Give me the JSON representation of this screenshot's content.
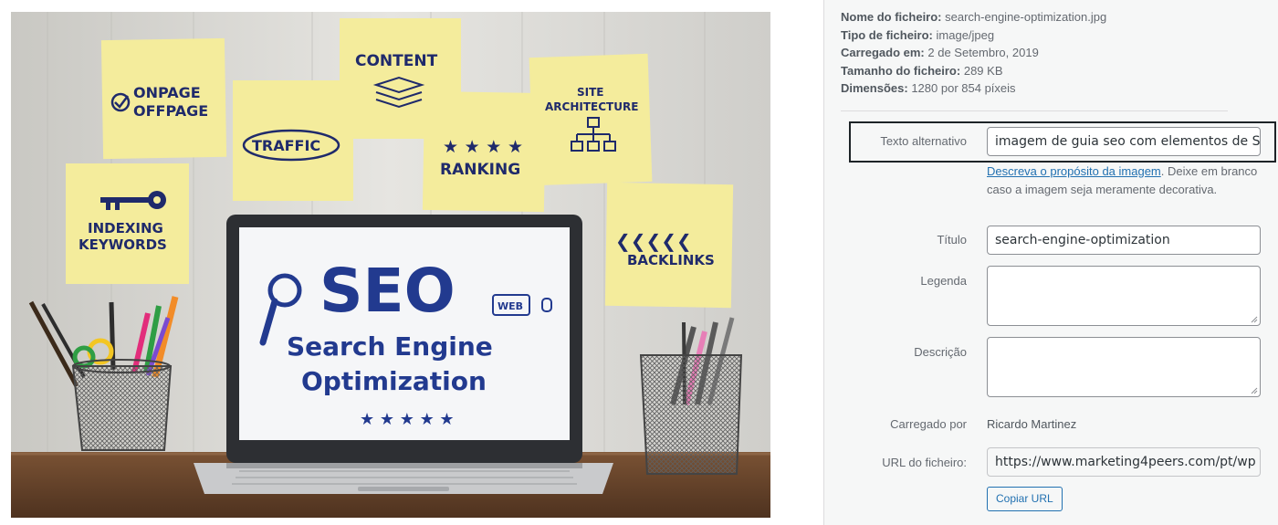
{
  "file_info": [
    {
      "label": "Nome do ficheiro:",
      "value": "search-engine-optimization.jpg"
    },
    {
      "label": "Tipo de ficheiro:",
      "value": "image/jpeg"
    },
    {
      "label": "Carregado em:",
      "value": "2 de Setembro, 2019"
    },
    {
      "label": "Tamanho do ficheiro:",
      "value": "289 KB"
    },
    {
      "label": "Dimensões:",
      "value": "1280 por 854 píxeis"
    }
  ],
  "fields": {
    "alt_text": {
      "label": "Texto alternativo",
      "value": "imagem de guia seo com elementos de S"
    },
    "alt_help": {
      "link": "Descreva o propósito da imagem",
      "text": ". Deixe em branco caso a imagem seja meramente decorativa."
    },
    "title": {
      "label": "Título",
      "value": "search-engine-optimization"
    },
    "caption": {
      "label": "Legenda",
      "value": ""
    },
    "description": {
      "label": "Descrição",
      "value": ""
    },
    "uploaded_by": {
      "label": "Carregado por",
      "value": "Ricardo Martinez"
    },
    "file_url": {
      "label": "URL do ficheiro:",
      "value": "https://www.marketing4peers.com/pt/wp"
    }
  },
  "copy_url_button": "Copiar URL",
  "photo": {
    "notes": [
      "ONPAGE",
      "OFFPAGE",
      "TRAFFIC",
      "CONTENT",
      "RANKING",
      "SITE",
      "ARCHITECTURE",
      "INDEXING",
      "KEYWORDS",
      "BACKLINKS"
    ],
    "screen_title": "SEO",
    "screen_web": "WEB",
    "screen_line1": "Search Engine",
    "screen_line2": "Optimization"
  },
  "colors": {
    "sticky_note": "#f4ec9c",
    "ink": "#1f2a6b",
    "wall": "#d9d8d3",
    "desk": "#6e4a30",
    "link": "#2271b1"
  }
}
